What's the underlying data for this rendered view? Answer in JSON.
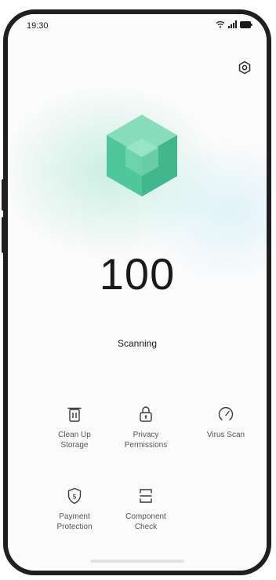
{
  "status_bar": {
    "time": "19:30",
    "icons": [
      "wifi-icon",
      "signal-icon",
      "battery-icon"
    ]
  },
  "header": {
    "settings_icon": "gear-icon"
  },
  "scan": {
    "score": "100",
    "status": "Scanning"
  },
  "tools": [
    {
      "label": "Clean Up\nStorage",
      "icon": "trash-icon"
    },
    {
      "label": "Privacy\nPermissions",
      "icon": "lock-icon"
    },
    {
      "label": "Virus Scan",
      "icon": "gauge-icon"
    },
    {
      "label": "Payment\nProtection",
      "icon": "shield-dollar-icon"
    },
    {
      "label": "Component\nCheck",
      "icon": "component-icon"
    }
  ],
  "colors": {
    "accent": "#4cc9a0",
    "text": "#1a1a1a",
    "secondary_text": "#555555"
  }
}
